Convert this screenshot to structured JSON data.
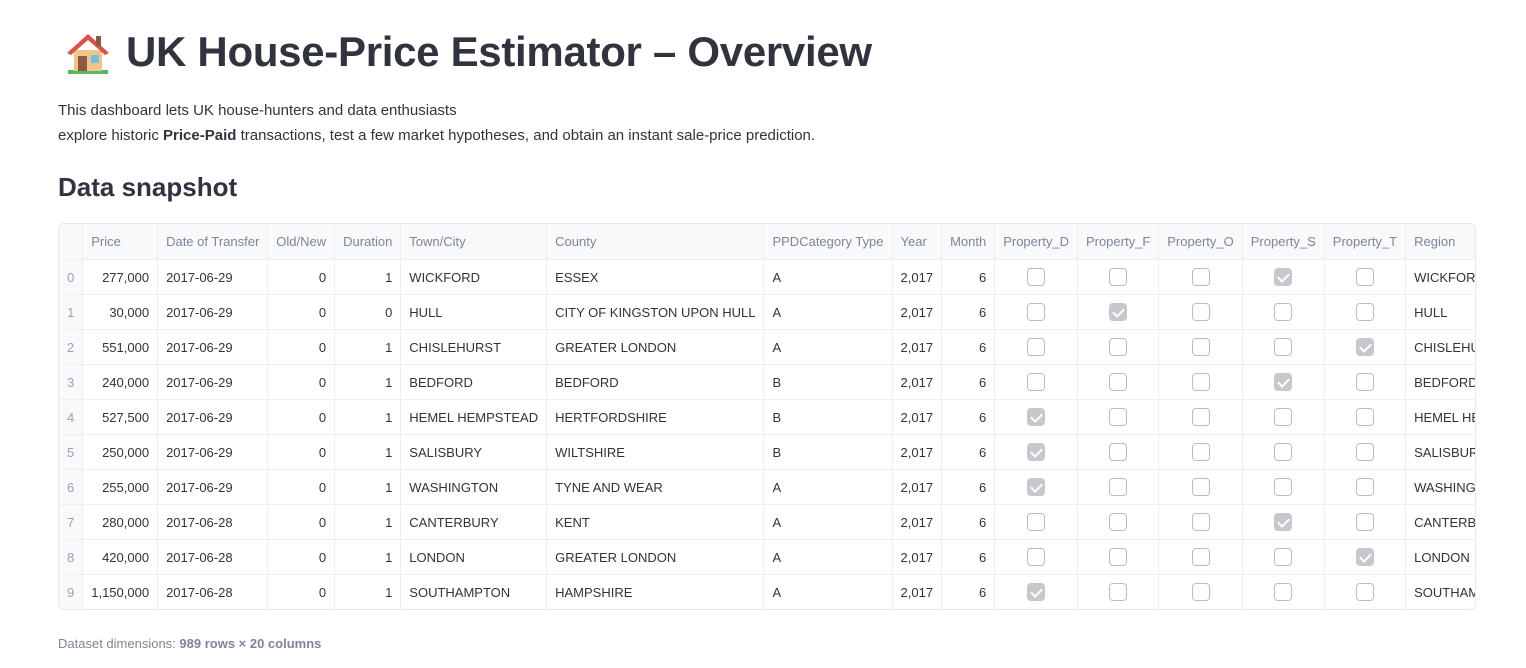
{
  "header": {
    "icon": "house-emoji-icon",
    "title": "UK House-Price Estimator – Overview"
  },
  "intro": {
    "line1": "This dashboard lets UK house-hunters and data enthusiasts",
    "line2_pre": "explore historic ",
    "line2_bold": "Price-Paid",
    "line2_post": " transactions, test a few market hypotheses, and obtain an instant sale-price prediction."
  },
  "section_title": "Data snapshot",
  "table": {
    "columns": [
      "",
      "Price",
      "Date of Transfer",
      "Old/New",
      "Duration",
      "Town/City",
      "County",
      "PPDCategory Type",
      "Year",
      "Month",
      "Property_D",
      "Property_F",
      "Property_O",
      "Property_S",
      "Property_T",
      "Region"
    ],
    "rows": [
      {
        "idx": "0",
        "price": "277,000",
        "date": "2017-06-29",
        "old_new": "0",
        "duration": "1",
        "town": "WICKFORD",
        "county": "ESSEX",
        "ppd": "A",
        "year": "2,017",
        "month": "6",
        "d": false,
        "f": false,
        "o": false,
        "s": true,
        "t": false,
        "region": "WICKFORD"
      },
      {
        "idx": "1",
        "price": "30,000",
        "date": "2017-06-29",
        "old_new": "0",
        "duration": "0",
        "town": "HULL",
        "county": "CITY OF KINGSTON UPON HULL",
        "ppd": "A",
        "year": "2,017",
        "month": "6",
        "d": false,
        "f": true,
        "o": false,
        "s": false,
        "t": false,
        "region": "HULL"
      },
      {
        "idx": "2",
        "price": "551,000",
        "date": "2017-06-29",
        "old_new": "0",
        "duration": "1",
        "town": "CHISLEHURST",
        "county": "GREATER LONDON",
        "ppd": "A",
        "year": "2,017",
        "month": "6",
        "d": false,
        "f": false,
        "o": false,
        "s": false,
        "t": true,
        "region": "CHISLEHUR"
      },
      {
        "idx": "3",
        "price": "240,000",
        "date": "2017-06-29",
        "old_new": "0",
        "duration": "1",
        "town": "BEDFORD",
        "county": "BEDFORD",
        "ppd": "B",
        "year": "2,017",
        "month": "6",
        "d": false,
        "f": false,
        "o": false,
        "s": true,
        "t": false,
        "region": "BEDFORD"
      },
      {
        "idx": "4",
        "price": "527,500",
        "date": "2017-06-29",
        "old_new": "0",
        "duration": "1",
        "town": "HEMEL HEMPSTEAD",
        "county": "HERTFORDSHIRE",
        "ppd": "B",
        "year": "2,017",
        "month": "6",
        "d": true,
        "f": false,
        "o": false,
        "s": false,
        "t": false,
        "region": "HEMEL HEM"
      },
      {
        "idx": "5",
        "price": "250,000",
        "date": "2017-06-29",
        "old_new": "0",
        "duration": "1",
        "town": "SALISBURY",
        "county": "WILTSHIRE",
        "ppd": "B",
        "year": "2,017",
        "month": "6",
        "d": true,
        "f": false,
        "o": false,
        "s": false,
        "t": false,
        "region": "SALISBURY"
      },
      {
        "idx": "6",
        "price": "255,000",
        "date": "2017-06-29",
        "old_new": "0",
        "duration": "1",
        "town": "WASHINGTON",
        "county": "TYNE AND WEAR",
        "ppd": "A",
        "year": "2,017",
        "month": "6",
        "d": true,
        "f": false,
        "o": false,
        "s": false,
        "t": false,
        "region": "WASHINGTO"
      },
      {
        "idx": "7",
        "price": "280,000",
        "date": "2017-06-28",
        "old_new": "0",
        "duration": "1",
        "town": "CANTERBURY",
        "county": "KENT",
        "ppd": "A",
        "year": "2,017",
        "month": "6",
        "d": false,
        "f": false,
        "o": false,
        "s": true,
        "t": false,
        "region": "CANTERBUR"
      },
      {
        "idx": "8",
        "price": "420,000",
        "date": "2017-06-28",
        "old_new": "0",
        "duration": "1",
        "town": "LONDON",
        "county": "GREATER LONDON",
        "ppd": "A",
        "year": "2,017",
        "month": "6",
        "d": false,
        "f": false,
        "o": false,
        "s": false,
        "t": true,
        "region": "LONDON"
      },
      {
        "idx": "9",
        "price": "1,150,000",
        "date": "2017-06-28",
        "old_new": "0",
        "duration": "1",
        "town": "SOUTHAMPTON",
        "county": "HAMPSHIRE",
        "ppd": "A",
        "year": "2,017",
        "month": "6",
        "d": true,
        "f": false,
        "o": false,
        "s": false,
        "t": false,
        "region": "SOUTHAMPT"
      }
    ]
  },
  "dimensions": {
    "label": "Dataset dimensions: ",
    "value": "989 rows × 20 columns"
  }
}
